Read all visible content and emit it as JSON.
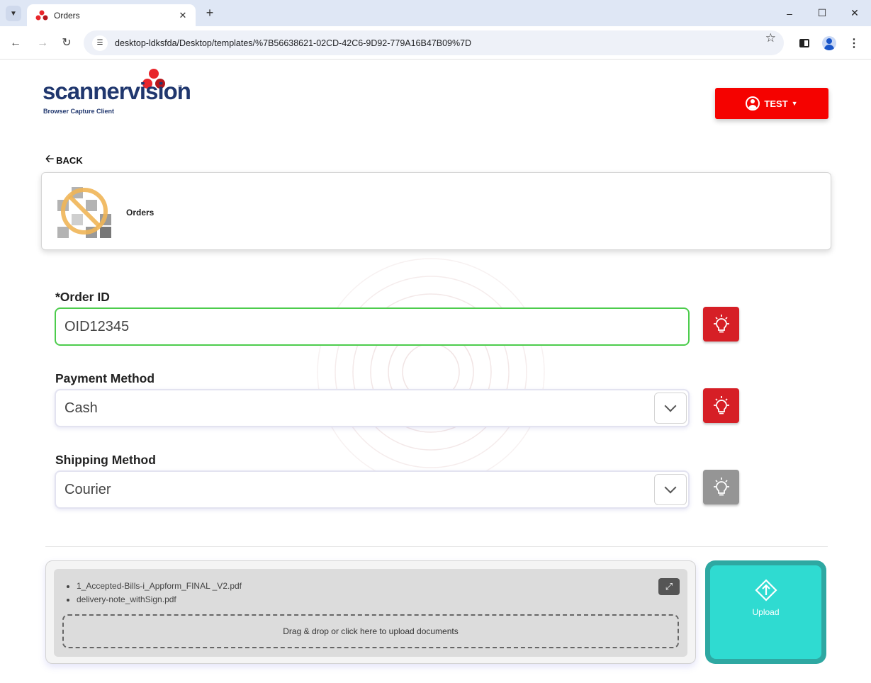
{
  "browser": {
    "tab_title": "Orders",
    "url": "desktop-ldksfda/Desktop/templates/%7B56638621-02CD-42C6-9D92-779A16B47B09%7D"
  },
  "header": {
    "logo_text": "scannervision",
    "logo_tm": "™",
    "logo_subtitle": "Browser Capture Client",
    "user_label": "TEST",
    "accent_color": "#f50200"
  },
  "nav": {
    "back_label": "BACK"
  },
  "document": {
    "title": "Orders"
  },
  "form": {
    "fields": [
      {
        "label": "*Order ID",
        "value": "OID12345",
        "type": "text",
        "hint_state": "active"
      },
      {
        "label": "Payment Method",
        "value": "Cash",
        "type": "select",
        "hint_state": "active"
      },
      {
        "label": "Shipping Method",
        "value": "Courier",
        "type": "select",
        "hint_state": "inactive"
      }
    ]
  },
  "upload": {
    "files": [
      "1_Accepted-Bills-i_Appform_FINAL _V2.pdf",
      "delivery-note_withSign.pdf"
    ],
    "drop_text": "Drag & drop or click here to upload documents",
    "button_label": "Upload",
    "button_color": "#2fdbd1"
  }
}
